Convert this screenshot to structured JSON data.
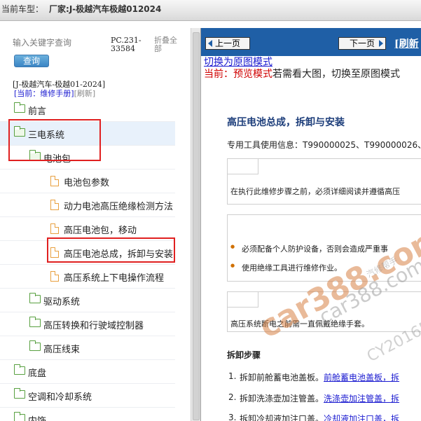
{
  "titlebar": {
    "label": "当前车型：",
    "maker_label": "厂家:",
    "maker_value": "J-极越汽车极越012024"
  },
  "search": {
    "placeholder": "输入关键字查询",
    "button": "查询",
    "pc_code": "PC.231-33584",
    "collapse_all": "折叠全部"
  },
  "context": {
    "brand": "[J-极越汽车-极越01-2024]",
    "current_prefix": "[当前：维修手册]",
    "refresh": "[刷新]"
  },
  "tree": [
    {
      "label": "前言",
      "type": "folder"
    },
    {
      "label": "三电系统",
      "type": "folder-open"
    },
    {
      "label": "电池包",
      "type": "folder-open"
    },
    {
      "label": "电池包参数",
      "type": "doc"
    },
    {
      "label": "动力电池高压绝缘检测方法",
      "type": "doc"
    },
    {
      "label": "高压电池包，移动",
      "type": "doc"
    },
    {
      "label": "高压电池总成，拆卸与安装",
      "type": "doc"
    },
    {
      "label": "高压系统上下电操作流程",
      "type": "doc"
    },
    {
      "label": "驱动系统",
      "type": "folder"
    },
    {
      "label": "高压转换和行驶域控制器",
      "type": "folder"
    },
    {
      "label": "高压线束",
      "type": "folder"
    },
    {
      "label": "底盘",
      "type": "folder"
    },
    {
      "label": "空调和冷却系统",
      "type": "folder"
    },
    {
      "label": "内饰",
      "type": "folder"
    }
  ],
  "nav": {
    "prev": "上一页",
    "next": "下一页",
    "refresh": "[刷新"
  },
  "content": {
    "switch_link": "切换为原图模式",
    "preview_red": "当前：预览模式",
    "preview_rest": "若需看大图，切换至原图模式",
    "title": "高压电池总成，拆卸与安装",
    "tools": "专用工具使用信息：T990000025、T990000026、",
    "notice": "在执行此维修步骤之前，必须详细阅读并遵循高压",
    "bullets": [
      "必须配备个人防护设备，否则会造成严重事",
      "使用绝缘工具进行维修作业。"
    ],
    "note": "高压系统断电之前需一直佩戴绝缘手套。",
    "steps_title": "拆卸步骤",
    "steps": [
      {
        "num": "1.",
        "text": "拆卸前舱蓄电池盖板。",
        "link": "前舱蓄电池盖板，拆"
      },
      {
        "num": "2.",
        "text": "拆卸洗涤壶加注管盖。",
        "link": "洗涤壶加注管盖，拆"
      },
      {
        "num": "3.",
        "text": "拆卸冷却液加注口盖。",
        "link": "冷却液加注口盖，拆"
      }
    ]
  },
  "watermark": {
    "main": "car388.com",
    "sub": "car388.com",
    "sub2": "CY20165",
    "tiny": "汽修帮手"
  }
}
